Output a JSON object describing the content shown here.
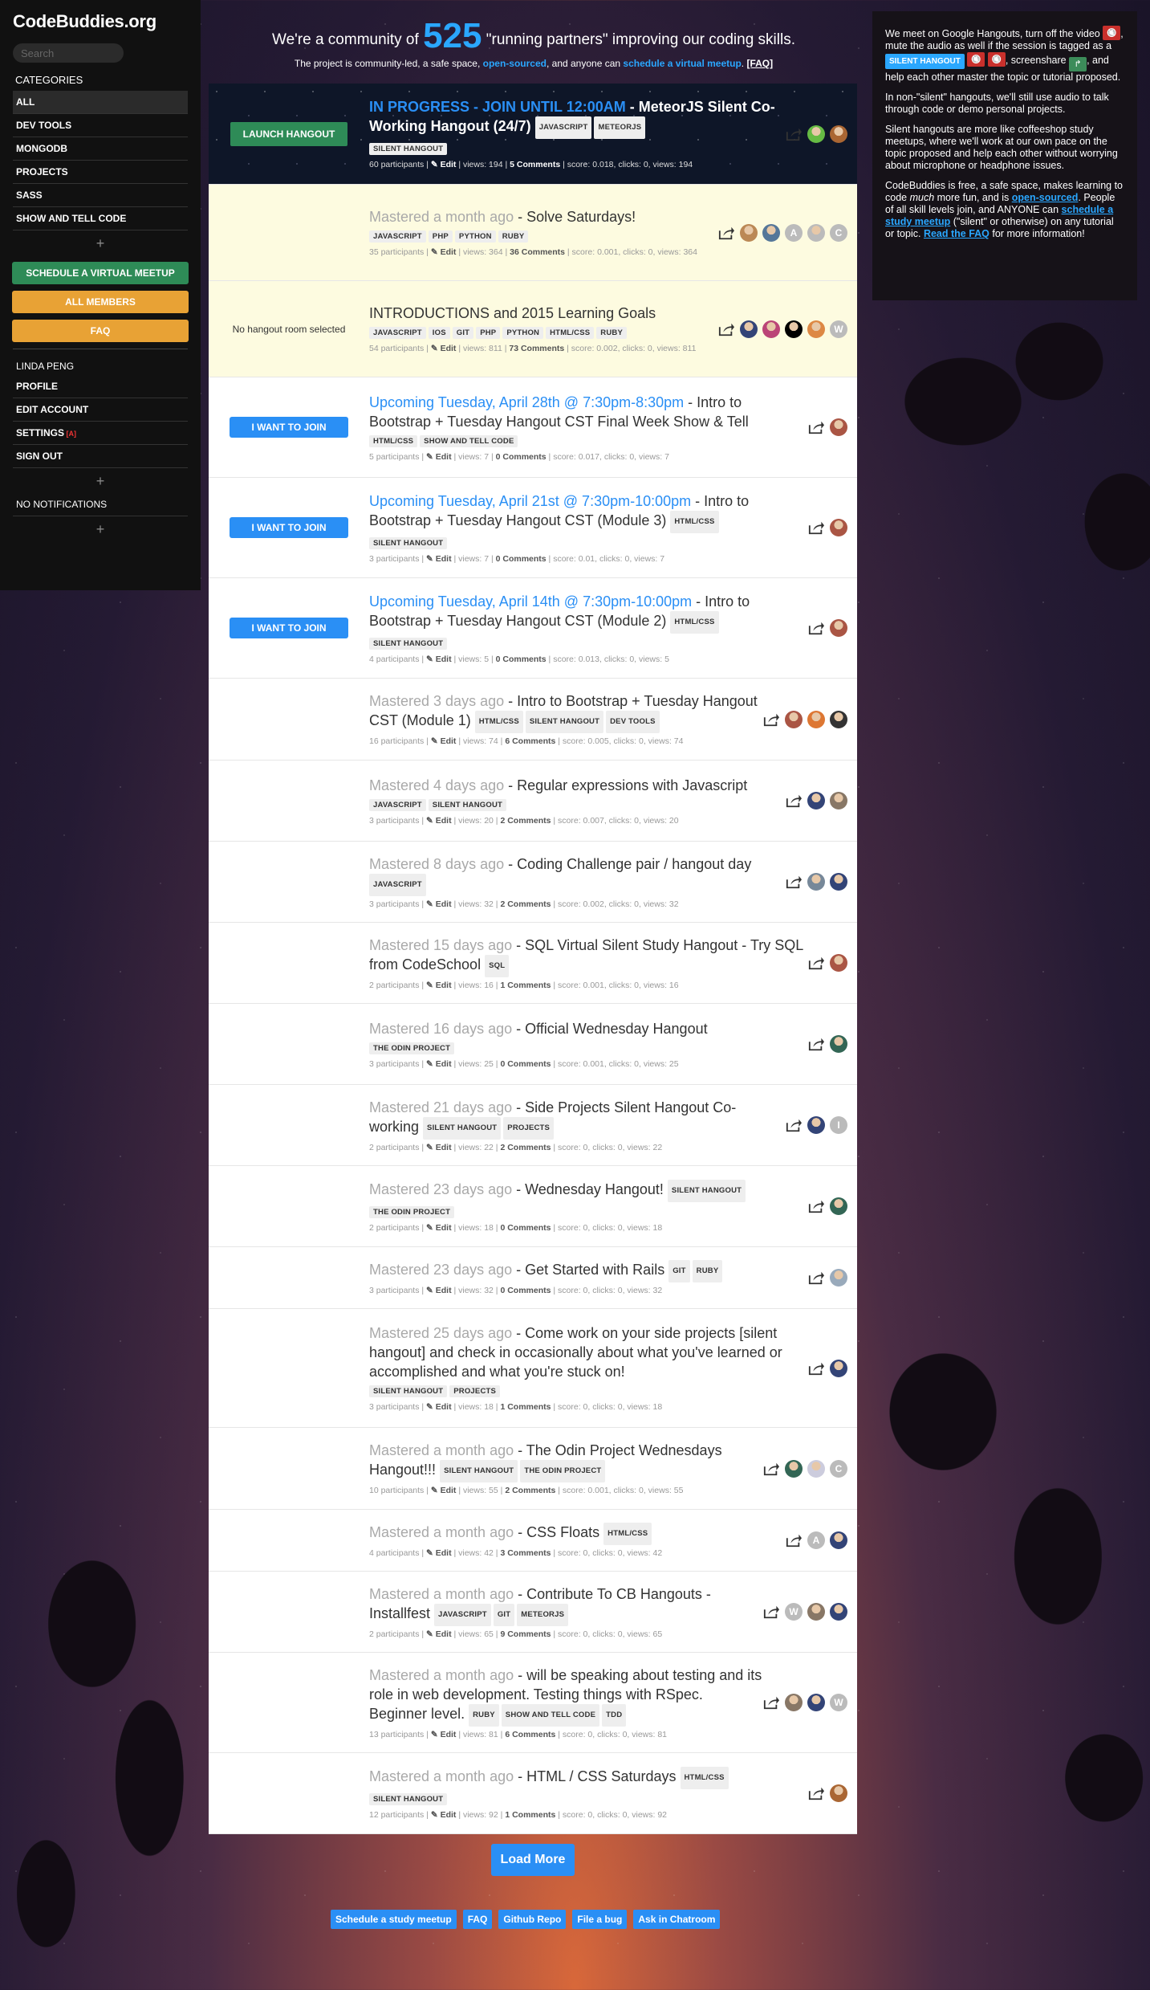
{
  "brand": "CodeBuddies.org",
  "search_placeholder": "Search",
  "sidebar": {
    "categories_label": "CATEGORIES",
    "categories": [
      "ALL",
      "DEV TOOLS",
      "MONGODB",
      "PROJECTS",
      "SASS",
      "SHOW AND TELL CODE"
    ],
    "schedule": "SCHEDULE A VIRTUAL MEETUP",
    "members": "ALL MEMBERS",
    "faq": "FAQ",
    "user": "LINDA PENG",
    "account": [
      "PROFILE",
      "EDIT ACCOUNT",
      "SETTINGS",
      "SIGN OUT"
    ],
    "settings_badge": "[A]",
    "notifications": "NO NOTIFICATIONS"
  },
  "header": {
    "pre": "We're a community of ",
    "count": "525",
    "post": " \"running partners\" improving our coding skills.",
    "line2_a": "The project is community-led, a safe space, ",
    "open_sourced": "open-sourced",
    "line2_b": ", and anyone can ",
    "schedule_link": "schedule a virtual meetup",
    "line2_c": ". ",
    "faq": "[FAQ]"
  },
  "info": {
    "p1_a": "We meet on Google Hangouts, turn off the video",
    "p1_b": ", mute the audio as well if the session is tagged as a",
    "p1_tag": "SILENT HANGOUT",
    "p1_c": ", screenshare",
    "p1_d": ", and help each other master the topic or tutorial proposed.",
    "p2": "In non-\"silent\" hangouts, we'll still use audio to talk through code or demo personal projects.",
    "p3": "Silent hangouts are more like coffeeshop study meetups, where we'll work at our own pace on the topic proposed and help each other without worrying about microphone or headphone issues.",
    "p4_a": "CodeBuddies is free, a safe space, makes learning to code ",
    "p4_much": "much",
    "p4_b": " more fun, and is ",
    "p4_os": "open-sourced",
    "p4_c": ". People of all skill levels join, and ANYONE can ",
    "p4_sched": "schedule a study meetup",
    "p4_d": " (\"silent\" or otherwise) on any tutorial or topic. ",
    "p4_faq": "Read the FAQ",
    "p4_e": " for more information!"
  },
  "feed": [
    {
      "style": "dark",
      "left": "LAUNCH HANGOUT",
      "status": "IN PROGRESS - JOIN UNTIL 12:00AM",
      "title": " - MeteorJS Silent Co-Working Hangout (24/7)",
      "tags": [
        "JAVASCRIPT",
        "METEORJS"
      ],
      "tags2": [
        "SILENT HANGOUT"
      ],
      "participants": "60 participants",
      "views": "views: 194",
      "comments": "5 Comments",
      "score": "score: 0.018, clicks: 0, views: 194",
      "avatars": [
        "#6b4",
        "#a63"
      ],
      "h": 126
    },
    {
      "style": "yellow",
      "left": "",
      "status": "Mastered a month ago",
      "statusClass": "mastered",
      "title": " - Solve Saturdays!",
      "tags": [],
      "tags2": [
        "JAVASCRIPT",
        "PHP",
        "PYTHON",
        "RUBY"
      ],
      "participants": "35 participants",
      "views": "views: 364",
      "comments": "36 Comments",
      "score": "score: 0.001, clicks: 0, views: 364",
      "avatars": [
        "#b85",
        "#579",
        "A",
        "#bbb",
        "C"
      ],
      "h": 120
    },
    {
      "style": "yellow",
      "left": "No hangout room selected",
      "status": "",
      "title": "INTRODUCTIONS and 2015 Learning Goals",
      "tags": [],
      "tags2": [
        "JAVASCRIPT",
        "IOS",
        "GIT",
        "PHP",
        "PYTHON",
        "HTML/CSS",
        "RUBY"
      ],
      "participants": "54 participants",
      "views": "views: 811",
      "comments": "73 Comments",
      "score": "score: 0.002, clicks: 0, views: 811",
      "avatars": [
        "#347",
        "#b47",
        "#000",
        "#d84",
        "W"
      ],
      "h": 120
    },
    {
      "style": "white",
      "left": "I WANT TO JOIN",
      "status": "Upcoming Tuesday, April 28th @ 7:30pm-8:30pm",
      "title": " - Intro to Bootstrap + Tuesday Hangout CST Final Week Show & Tell",
      "tags": [],
      "tags2": [
        "HTML/CSS",
        "SHOW AND TELL CODE"
      ],
      "participants": "5 participants",
      "views": "views: 7",
      "comments": "0 Comments",
      "score": "score: 0.017, clicks: 0, views: 7",
      "avatars": [
        "#a54"
      ],
      "h": 125
    },
    {
      "style": "white",
      "left": "I WANT TO JOIN",
      "status": "Upcoming Tuesday, April 21st @ 7:30pm-10:00pm",
      "title": " - Intro to Bootstrap + Tuesday Hangout CST (Module 3)",
      "tags": [
        "HTML/CSS"
      ],
      "tags2": [
        "SILENT HANGOUT"
      ],
      "participants": "3 participants",
      "views": "views: 7",
      "comments": "0 Comments",
      "score": "score: 0.01, clicks: 0, views: 7",
      "avatars": [
        "#a54"
      ],
      "h": 125
    },
    {
      "style": "white",
      "left": "I WANT TO JOIN",
      "status": "Upcoming Tuesday, April 14th @ 7:30pm-10:00pm",
      "title": " - Intro to Bootstrap + Tuesday Hangout CST (Module 2)",
      "tags": [
        "HTML/CSS"
      ],
      "tags2": [
        "SILENT HANGOUT"
      ],
      "participants": "4 participants",
      "views": "views: 5",
      "comments": "0 Comments",
      "score": "score: 0.013, clicks: 0, views: 5",
      "avatars": [
        "#a54"
      ],
      "h": 125
    },
    {
      "style": "white",
      "left": "",
      "status": "Mastered 3 days ago",
      "statusClass": "mastered",
      "title": " - Intro to Bootstrap + Tuesday Hangout CST (Module 1)",
      "tags": [
        "HTML/CSS",
        "SILENT HANGOUT",
        "DEV TOOLS"
      ],
      "tags2": [],
      "participants": "16 participants",
      "views": "views: 74",
      "comments": "6 Comments",
      "score": "score: 0.005, clicks: 0, views: 74",
      "avatars": [
        "#a54",
        "#d73",
        "#333"
      ],
      "h": 102
    },
    {
      "style": "white",
      "left": "",
      "status": "Mastered 4 days ago",
      "statusClass": "mastered",
      "title": " - Regular expressions with Javascript",
      "tags": [],
      "tags2": [
        "JAVASCRIPT",
        "SILENT HANGOUT"
      ],
      "participants": "3 participants",
      "views": "views: 20",
      "comments": "2 Comments",
      "score": "score: 0.007, clicks: 0, views: 20",
      "avatars": [
        "#347",
        "#876"
      ],
      "h": 101
    },
    {
      "style": "white",
      "left": "",
      "status": "Mastered 8 days ago",
      "statusClass": "mastered",
      "title": " - Coding Challenge pair / hangout day",
      "tags": [
        "JAVASCRIPT"
      ],
      "tags2": [],
      "participants": "3 participants",
      "views": "views: 32",
      "comments": "2 Comments",
      "score": "score: 0.002, clicks: 0, views: 32",
      "avatars": [
        "#789",
        "#347"
      ],
      "h": 101
    },
    {
      "style": "white",
      "left": "",
      "status": "Mastered 15 days ago",
      "statusClass": "mastered",
      "title": " - SQL Virtual Silent Study Hangout - Try SQL from CodeSchool",
      "tags": [
        "SQL"
      ],
      "tags2": [],
      "participants": "2 participants",
      "views": "views: 16",
      "comments": "1 Comments",
      "score": "score: 0.001, clicks: 0, views: 16",
      "avatars": [
        "#a54"
      ],
      "h": 101
    },
    {
      "style": "white",
      "left": "",
      "status": "Mastered 16 days ago",
      "statusClass": "mastered",
      "title": " - Official Wednesday Hangout",
      "tags": [],
      "tags2": [
        "THE ODIN PROJECT"
      ],
      "participants": "3 participants",
      "views": "views: 25",
      "comments": "0 Comments",
      "score": "score: 0.001, clicks: 0, views: 25",
      "avatars": [
        "#365"
      ],
      "h": 101
    },
    {
      "style": "white",
      "left": "",
      "status": "Mastered 21 days ago",
      "statusClass": "mastered",
      "title": " - Side Projects Silent Hangout Co-working",
      "tags": [
        "SILENT HANGOUT",
        "PROJECTS"
      ],
      "tags2": [],
      "participants": "2 participants",
      "views": "views: 22",
      "comments": "2 Comments",
      "score": "score: 0, clicks: 0, views: 22",
      "avatars": [
        "#347",
        "I"
      ],
      "h": 101
    },
    {
      "style": "white",
      "left": "",
      "status": "Mastered 23 days ago",
      "statusClass": "mastered",
      "title": " - Wednesday Hangout!",
      "tags": [
        "SILENT HANGOUT"
      ],
      "tags2": [
        "THE ODIN PROJECT"
      ],
      "participants": "2 participants",
      "views": "views: 18",
      "comments": "0 Comments",
      "score": "score: 0, clicks: 0, views: 18",
      "avatars": [
        "#365"
      ],
      "h": 101
    },
    {
      "style": "white",
      "left": "",
      "status": "Mastered 23 days ago",
      "statusClass": "mastered",
      "title": " - Get Started with Rails",
      "tags": [
        "GIT",
        "RUBY"
      ],
      "tags2": [],
      "participants": "3 participants",
      "views": "views: 32",
      "comments": "0 Comments",
      "score": "score: 0, clicks: 0, views: 32",
      "avatars": [
        "#9ab"
      ],
      "h": 77
    },
    {
      "style": "white",
      "left": "",
      "status": "Mastered 25 days ago",
      "statusClass": "mastered",
      "title": " - Come work on your side projects [silent hangout] and check in occasionally about what you've learned or accomplished and what you're stuck on!",
      "tags": [],
      "tags2": [
        "SILENT HANGOUT",
        "PROJECTS"
      ],
      "participants": "3 participants",
      "views": "views: 18",
      "comments": "1 Comments",
      "score": "score: 0, clicks: 0, views: 18",
      "avatars": [
        "#347"
      ],
      "h": 148
    },
    {
      "style": "white",
      "left": "",
      "status": "Mastered a month ago",
      "statusClass": "mastered",
      "title": " - The Odin Project Wednesdays Hangout!!!",
      "tags": [
        "SILENT HANGOUT",
        "THE ODIN PROJECT"
      ],
      "tags2": [],
      "participants": "10 participants",
      "views": "views: 55",
      "comments": "2 Comments",
      "score": "score: 0.001, clicks: 0, views: 55",
      "avatars": [
        "#365",
        "#ccd",
        "C"
      ],
      "h": 102
    },
    {
      "style": "white",
      "left": "",
      "status": "Mastered a month ago",
      "statusClass": "mastered",
      "title": " - CSS Floats",
      "tags": [
        "HTML/CSS"
      ],
      "tags2": [],
      "participants": "4 participants",
      "views": "views: 42",
      "comments": "3 Comments",
      "score": "score: 0, clicks: 0, views: 42",
      "avatars": [
        "A",
        "#347"
      ],
      "h": 77
    },
    {
      "style": "white",
      "left": "",
      "status": "Mastered a month ago",
      "statusClass": "mastered",
      "title": " - Contribute To CB Hangouts - Installfest",
      "tags": [
        "JAVASCRIPT",
        "GIT",
        "METEORJS"
      ],
      "tags2": [],
      "participants": "2 participants",
      "views": "views: 65",
      "comments": "9 Comments",
      "score": "score: 0, clicks: 0, views: 65",
      "avatars": [
        "W",
        "#876",
        "#347"
      ],
      "h": 101
    },
    {
      "style": "white",
      "left": "",
      "status": "Mastered a month ago",
      "statusClass": "mastered",
      "title": " - will be speaking about testing and its role in web development. Testing things with RSpec. Beginner level.",
      "tags": [
        "RUBY",
        "SHOW AND TELL CODE",
        "TDD"
      ],
      "tags2": [],
      "participants": "13 participants",
      "views": "views: 81",
      "comments": "6 Comments",
      "score": "score: 0, clicks: 0, views: 81",
      "avatars": [
        "#876",
        "#347",
        "W"
      ],
      "h": 125
    },
    {
      "style": "white",
      "left": "",
      "status": "Mastered a month ago",
      "statusClass": "mastered",
      "title": " - HTML / CSS Saturdays",
      "tags": [
        "HTML/CSS"
      ],
      "tags2": [
        "SILENT HANGOUT"
      ],
      "participants": "12 participants",
      "views": "views: 92",
      "comments": "1 Comments",
      "score": "score: 0, clicks: 0, views: 92",
      "avatars": [
        "#a63"
      ],
      "h": 101
    }
  ],
  "edit_label": "Edit",
  "load_more": "Load More",
  "footer_links": [
    "Schedule a study meetup",
    "FAQ",
    "Github Repo",
    "File a bug",
    "Ask in Chatroom"
  ]
}
